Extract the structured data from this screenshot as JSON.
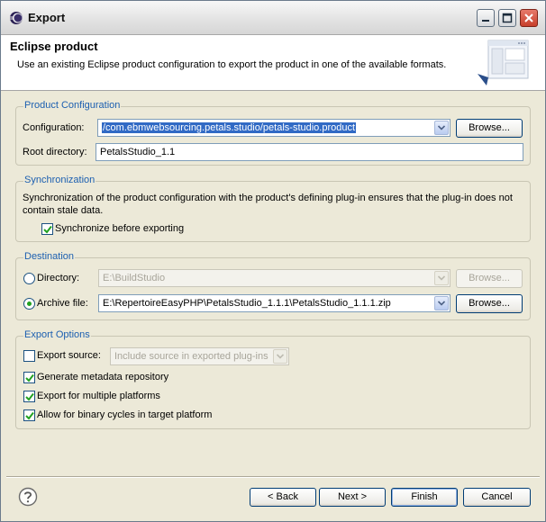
{
  "window": {
    "title": "Export"
  },
  "banner": {
    "title": "Eclipse product",
    "description": "Use an existing Eclipse product configuration to export the product in one of the available formats."
  },
  "product_config": {
    "group_title": "Product Configuration",
    "configuration_label": "Configuration:",
    "configuration_value": "/com.ebmwebsourcing.petals.studio/petals-studio.product",
    "browse_label": "Browse...",
    "root_label": "Root directory:",
    "root_value": "PetalsStudio_1.1"
  },
  "sync": {
    "group_title": "Synchronization",
    "description_line1": "Synchronization of the product configuration with the product's defining plug-in ensures that the plug-in does not",
    "description_line2": "contain stale data.",
    "checkbox_label": "Synchronize before exporting",
    "checked": true
  },
  "destination": {
    "group_title": "Destination",
    "directory_label": "Directory:",
    "directory_value": "E:\\BuildStudio",
    "directory_selected": false,
    "archive_label": "Archive file:",
    "archive_value": "E:\\RepertoireEasyPHP\\PetalsStudio_1.1.1\\PetalsStudio_1.1.1.zip",
    "archive_selected": true,
    "browse_label": "Browse..."
  },
  "export_options": {
    "group_title": "Export Options",
    "export_source_label": "Export source:",
    "export_source_checked": false,
    "export_source_select": "Include source in exported plug-ins",
    "metadata_label": "Generate metadata repository",
    "metadata_checked": true,
    "multi_platform_label": "Export for multiple platforms",
    "multi_platform_checked": true,
    "binary_cycles_label": "Allow for binary cycles in target platform",
    "binary_cycles_checked": true
  },
  "footer": {
    "back_label": "< Back",
    "next_label": "Next >",
    "finish_label": "Finish",
    "cancel_label": "Cancel"
  },
  "colors": {
    "group_title": "#1c5fb0",
    "selection": "#316ac5",
    "close_button": "#c73f2b"
  }
}
